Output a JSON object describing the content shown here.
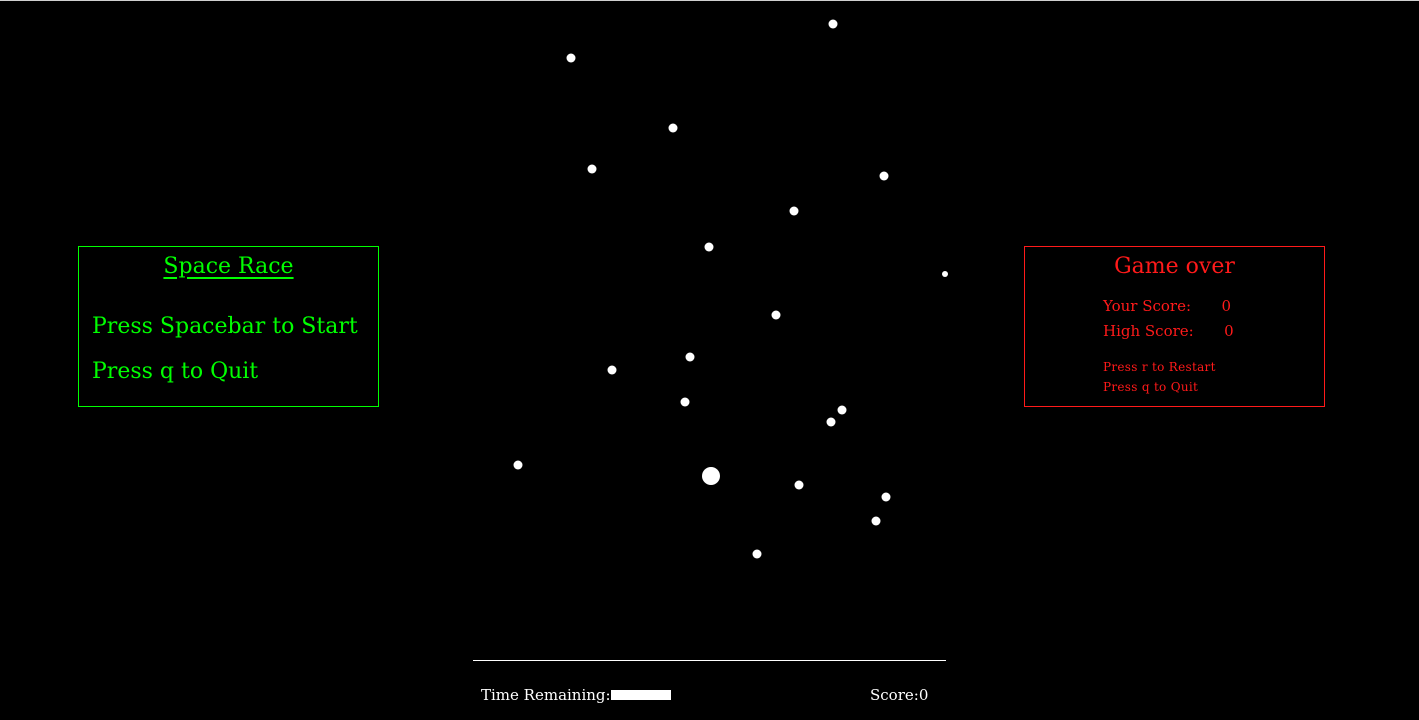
{
  "start_panel": {
    "title": "Space Race",
    "line1": "Press Spacebar to Start",
    "line2": "Press q to Quit",
    "color": "#00ff00"
  },
  "gameover_panel": {
    "title": "Game over",
    "your_score_label": "Your Score:",
    "your_score_value": "0",
    "high_score_label": "High Score:",
    "high_score_value": "0",
    "restart_hint": "Press r to Restart",
    "quit_hint": "Press q to Quit",
    "color": "#ff1a1a"
  },
  "hud": {
    "time_label": "Time Remaining:",
    "time_remaining_fraction": 1.0,
    "score_label": "Score:",
    "score_value": "0"
  },
  "entities": {
    "asteroid_icon": "white-dot",
    "player_icon": "white-circle"
  }
}
